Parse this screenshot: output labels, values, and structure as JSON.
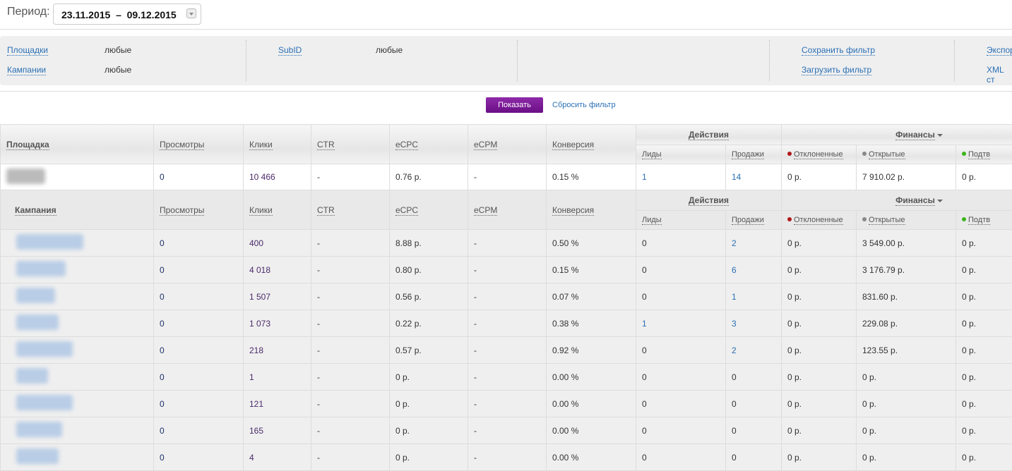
{
  "period": {
    "label": "Период:",
    "value": "23.11.2015  –  09.12.2015"
  },
  "filters": {
    "platforms_label": "Площадки",
    "platforms_value": "любые",
    "campaigns_label": "Кампании",
    "campaigns_value": "любые",
    "subid_label": "SubID",
    "subid_value": "любые",
    "save_filter": "Сохранить фильтр",
    "load_filter": "Загрузить фильтр",
    "export": "Экспор",
    "xml": "XML ст"
  },
  "buttons": {
    "show": "Показать",
    "reset": "Сбросить фильтр"
  },
  "columns": {
    "platform": "Площадка",
    "campaign": "Кампания",
    "views": "Просмотры",
    "clicks": "Клики",
    "ctr": "CTR",
    "ecpc": "eCPC",
    "ecpm": "eCPM",
    "conversion": "Конверсия",
    "actions": "Действия",
    "leads": "Лиды",
    "sales": "Продажи",
    "finance": "Финансы",
    "rejected": "Отклоненные",
    "open": "Открытые",
    "confirmed": "Подтв"
  },
  "colors": {
    "accent": "#7a1a96",
    "link": "#2a6fb4",
    "rejected": "#b01818",
    "open": "#888888",
    "confirmed": "#3bb51a"
  },
  "summary": {
    "views": "0",
    "clicks": "10 466",
    "ctr": "-",
    "ecpc": "0.76 р.",
    "ecpm": "-",
    "conversion": "0.15 %",
    "leads": "1",
    "sales": "14",
    "rejected": "0 р.",
    "open": "7 910.02 р.",
    "confirmed": "0 р."
  },
  "rows": [
    {
      "views": "0",
      "clicks": "400",
      "ctr": "-",
      "ecpc": "8.88 р.",
      "ecpm": "-",
      "conversion": "0.50 %",
      "leads": "0",
      "sales": "2",
      "rejected": "0 р.",
      "open": "3 549.00 р.",
      "confirmed": "0 р."
    },
    {
      "views": "0",
      "clicks": "4 018",
      "ctr": "-",
      "ecpc": "0.80 р.",
      "ecpm": "-",
      "conversion": "0.15 %",
      "leads": "0",
      "sales": "6",
      "rejected": "0 р.",
      "open": "3 176.79 р.",
      "confirmed": "0 р."
    },
    {
      "views": "0",
      "clicks": "1 507",
      "ctr": "-",
      "ecpc": "0.56 р.",
      "ecpm": "-",
      "conversion": "0.07 %",
      "leads": "0",
      "sales": "1",
      "rejected": "0 р.",
      "open": "831.60 р.",
      "confirmed": "0 р."
    },
    {
      "views": "0",
      "clicks": "1 073",
      "ctr": "-",
      "ecpc": "0.22 р.",
      "ecpm": "-",
      "conversion": "0.38 %",
      "leads": "1",
      "sales": "3",
      "rejected": "0 р.",
      "open": "229.08 р.",
      "confirmed": "0 р."
    },
    {
      "views": "0",
      "clicks": "218",
      "ctr": "-",
      "ecpc": "0.57 р.",
      "ecpm": "-",
      "conversion": "0.92 %",
      "leads": "0",
      "sales": "2",
      "rejected": "0 р.",
      "open": "123.55 р.",
      "confirmed": "0 р."
    },
    {
      "views": "0",
      "clicks": "1",
      "ctr": "-",
      "ecpc": "0 р.",
      "ecpm": "-",
      "conversion": "0.00 %",
      "leads": "0",
      "sales": "0",
      "rejected": "0 р.",
      "open": "0 р.",
      "confirmed": "0 р."
    },
    {
      "views": "0",
      "clicks": "121",
      "ctr": "-",
      "ecpc": "0 р.",
      "ecpm": "-",
      "conversion": "0.00 %",
      "leads": "0",
      "sales": "0",
      "rejected": "0 р.",
      "open": "0 р.",
      "confirmed": "0 р."
    },
    {
      "views": "0",
      "clicks": "165",
      "ctr": "-",
      "ecpc": "0 р.",
      "ecpm": "-",
      "conversion": "0.00 %",
      "leads": "0",
      "sales": "0",
      "rejected": "0 р.",
      "open": "0 р.",
      "confirmed": "0 р."
    },
    {
      "views": "0",
      "clicks": "4",
      "ctr": "-",
      "ecpc": "0 р.",
      "ecpm": "-",
      "conversion": "0.00 %",
      "leads": "0",
      "sales": "0",
      "rejected": "0 р.",
      "open": "0 р.",
      "confirmed": "0 р."
    }
  ]
}
